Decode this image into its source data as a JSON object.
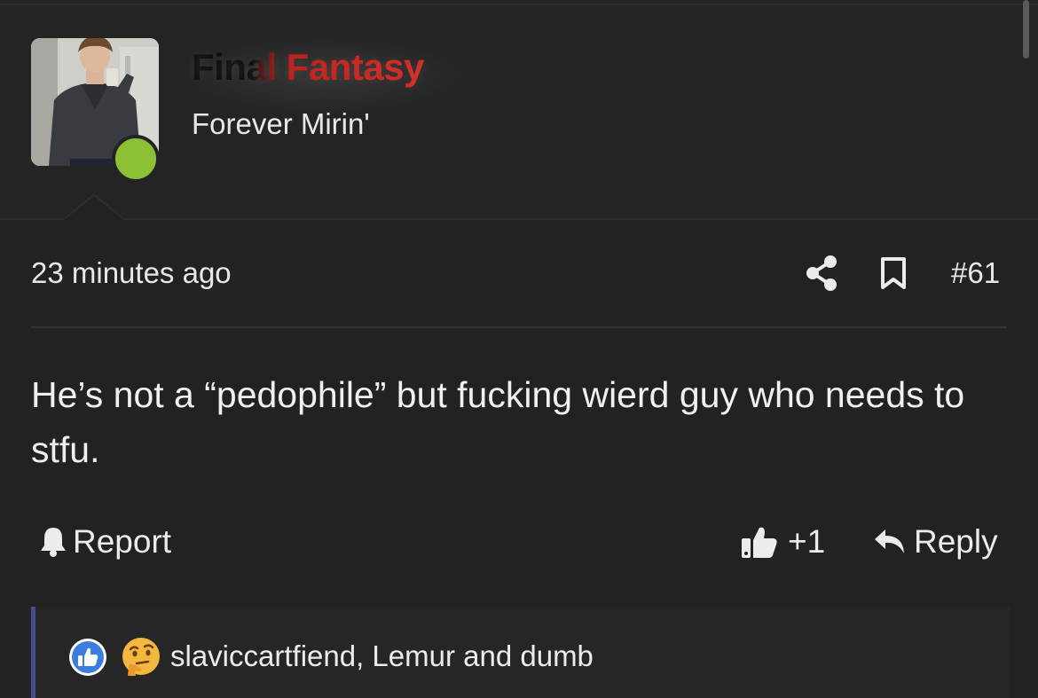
{
  "user": {
    "name": "Final Fantasy",
    "title": "Forever Mirin'",
    "avatar_icon": "user-avatar-photo",
    "online_color": "#8cc136"
  },
  "post": {
    "timestamp": "23 minutes ago",
    "number": "#61",
    "body": "He’s not a “pedophile” but fucking wierd guy who needs to stfu.",
    "share_icon": "share-icon",
    "bookmark_icon": "bookmark-icon"
  },
  "actions": {
    "report_label": "Report",
    "like_count": "+1",
    "reply_label": "Reply"
  },
  "reactions": {
    "icons": [
      "like-reaction-icon",
      "thinking-face-icon"
    ],
    "users": "slaviccartfiend, Lemur and dumb"
  },
  "colors": {
    "background": "#222222",
    "reaction_bar_accent": "#4a4b8f",
    "username_gradient": [
      "#0d0d0d",
      "#d42a22"
    ]
  }
}
